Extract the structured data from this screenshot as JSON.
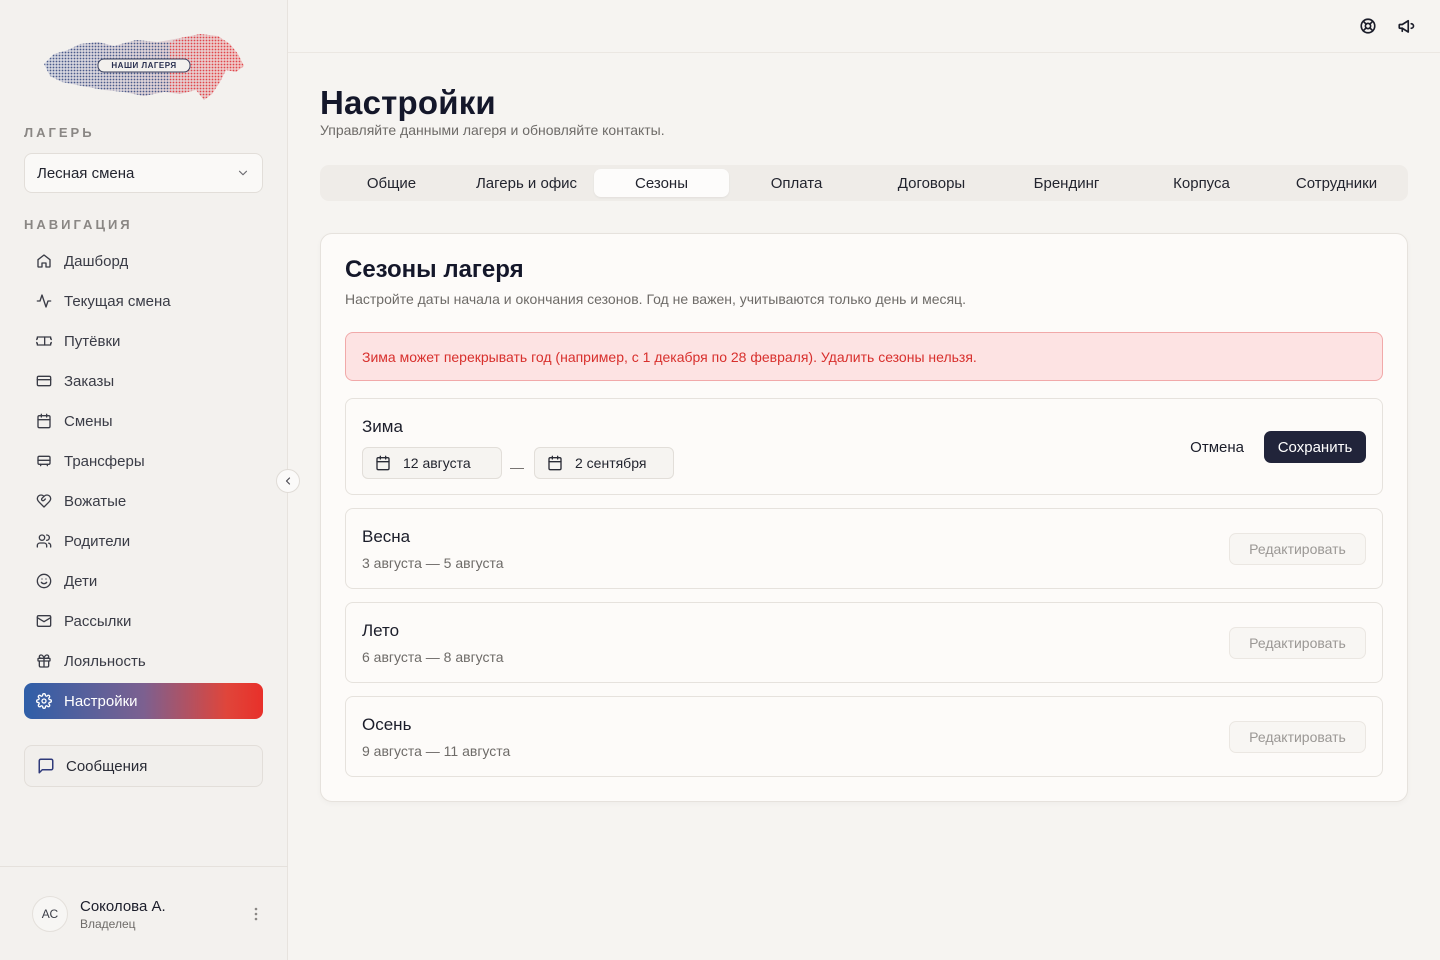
{
  "logo": {
    "text": "НАШИ ЛАГЕРЯ"
  },
  "sidebar": {
    "camp_label": "ЛАГЕРЬ",
    "camp_value": "Лесная смена",
    "nav_label": "НАВИГАЦИЯ",
    "items": [
      {
        "label": "Дашборд",
        "icon": "home-icon"
      },
      {
        "label": "Текущая смена",
        "icon": "activity-icon"
      },
      {
        "label": "Путёвки",
        "icon": "ticket-icon"
      },
      {
        "label": "Заказы",
        "icon": "credit-card-icon"
      },
      {
        "label": "Смены",
        "icon": "calendar-icon"
      },
      {
        "label": "Трансферы",
        "icon": "bus-icon"
      },
      {
        "label": "Вожатые",
        "icon": "heart-handshake-icon"
      },
      {
        "label": "Родители",
        "icon": "users-icon"
      },
      {
        "label": "Дети",
        "icon": "smile-icon"
      },
      {
        "label": "Рассылки",
        "icon": "mail-icon"
      },
      {
        "label": "Лояльность",
        "icon": "gift-icon"
      },
      {
        "label": "Настройки",
        "icon": "settings-icon",
        "active": true
      }
    ],
    "messages_label": "Сообщения",
    "user": {
      "initials": "АС",
      "name": "Соколова А.",
      "role": "Владелец"
    }
  },
  "header": {
    "help_icon": "lifebuoy-icon",
    "announce_icon": "megaphone-icon"
  },
  "page": {
    "title": "Настройки",
    "subtitle": "Управляйте данными лагеря и обновляйте контакты."
  },
  "tabs": [
    "Общие",
    "Лагерь и офис",
    "Сезоны",
    "Оплата",
    "Договоры",
    "Брендинг",
    "Корпуса",
    "Сотрудники"
  ],
  "active_tab": "Сезоны",
  "card": {
    "title": "Сезоны лагеря",
    "subtitle": "Настройте даты начала и окончания сезонов. Год не важен, учитываются только день и месяц.",
    "alert": "Зима может перекрывать год (например, с 1 декабря по 28 февраля). Удалить сезоны нельзя."
  },
  "editing_season": {
    "name": "Зима",
    "start": "12 августа",
    "end": "2 сентября",
    "separator": "—",
    "cancel_label": "Отмена",
    "save_label": "Сохранить"
  },
  "seasons": [
    {
      "name": "Весна",
      "range": "3 августа — 5 августа",
      "edit_label": "Редактировать"
    },
    {
      "name": "Лето",
      "range": "6 августа — 8 августа",
      "edit_label": "Редактировать"
    },
    {
      "name": "Осень",
      "range": "9 августа — 11 августа",
      "edit_label": "Редактировать"
    }
  ],
  "colors": {
    "accent_dark": "#21243a",
    "alert_red": "#d8302d",
    "gradient_blue": "#2f5fa8",
    "gradient_red": "#e8302a"
  }
}
